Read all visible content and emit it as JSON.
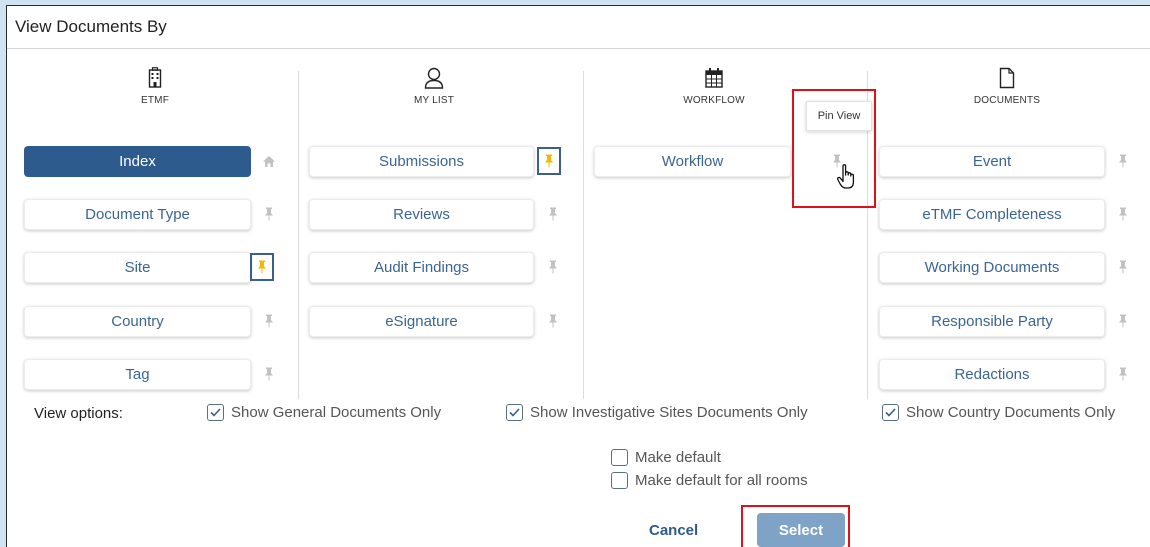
{
  "dialog": {
    "title": "View Documents By"
  },
  "columns": [
    {
      "label": "ETMF",
      "icon": "building-icon"
    },
    {
      "label": "MY LIST",
      "icon": "user-icon"
    },
    {
      "label": "WORKFLOW",
      "icon": "calendar-icon"
    },
    {
      "label": "DOCUMENTS",
      "icon": "document-icon"
    }
  ],
  "etmf": {
    "items": [
      {
        "label": "Index",
        "active": true,
        "pin": "home"
      },
      {
        "label": "Document Type",
        "pin": "unpinned"
      },
      {
        "label": "Site",
        "pin": "pinned"
      },
      {
        "label": "Country",
        "pin": "unpinned"
      },
      {
        "label": "Tag",
        "pin": "unpinned"
      }
    ]
  },
  "mylist": {
    "items": [
      {
        "label": "Submissions",
        "pin": "pinned"
      },
      {
        "label": "Reviews",
        "pin": "unpinned"
      },
      {
        "label": "Audit Findings",
        "pin": "unpinned"
      },
      {
        "label": "eSignature",
        "pin": "unpinned"
      }
    ]
  },
  "workflow": {
    "items": [
      {
        "label": "Workflow",
        "pin": "hover"
      }
    ],
    "tooltip": "Pin View"
  },
  "documents": {
    "items": [
      {
        "label": "Event",
        "pin": "unpinned"
      },
      {
        "label": "eTMF Completeness",
        "pin": "unpinned"
      },
      {
        "label": "Working Documents",
        "pin": "unpinned"
      },
      {
        "label": "Responsible Party",
        "pin": "unpinned"
      },
      {
        "label": "Redactions",
        "pin": "unpinned"
      }
    ]
  },
  "options": {
    "label": "View options:",
    "general": "Show General Documents Only",
    "investigative": "Show Investigative Sites Documents Only",
    "country": "Show Country Documents Only",
    "make_default": "Make default",
    "make_default_all": "Make default for all rooms"
  },
  "actions": {
    "cancel": "Cancel",
    "select": "Select"
  },
  "colors": {
    "primary": "#2e5b8e",
    "link": "#3b6592",
    "pin_active": "#f5b800",
    "pin_inactive": "#c2c2c2",
    "highlight": "#e0101a",
    "select_disabled": "#7ea3c7"
  }
}
